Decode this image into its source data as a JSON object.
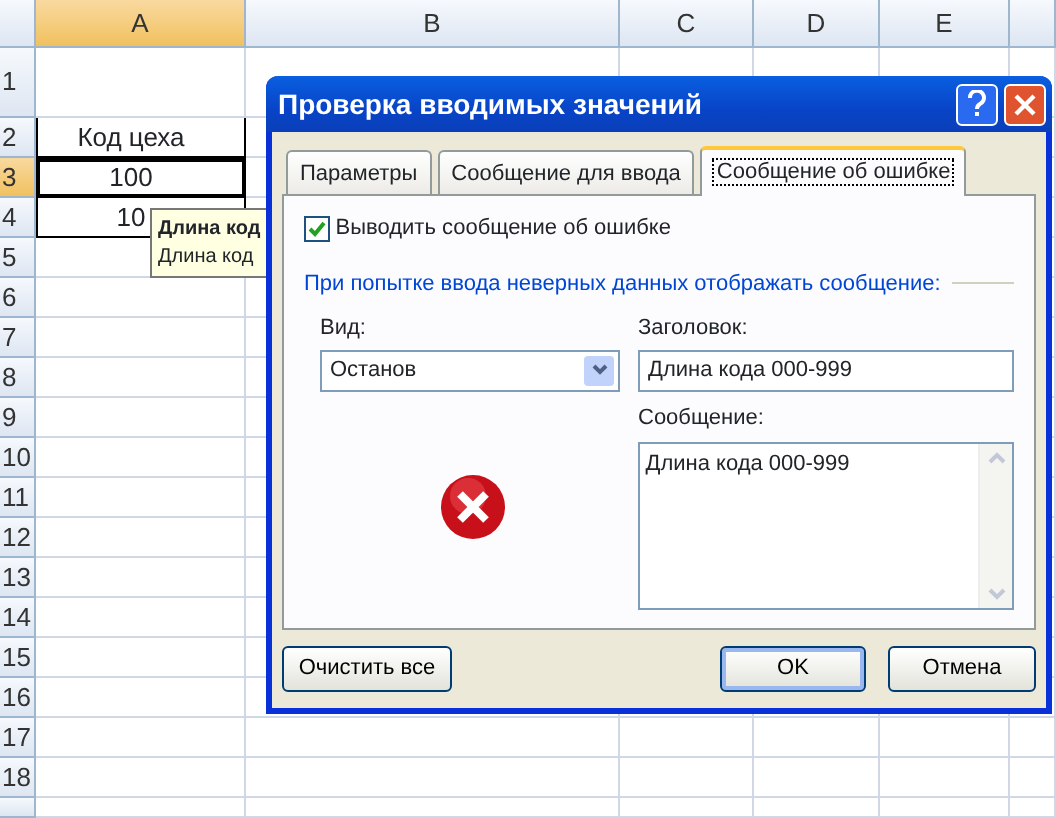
{
  "sheet": {
    "columns": [
      "A",
      "B",
      "C",
      "D",
      "E"
    ],
    "rows": [
      {
        "header": "1",
        "cells": []
      },
      {
        "header": "2",
        "cells": [
          {
            "text": "Код цеха",
            "selected": false
          }
        ]
      },
      {
        "header": "3",
        "cells": [
          {
            "text": "100",
            "selected": true
          }
        ]
      },
      {
        "header": "4",
        "cells": [
          {
            "text": "10",
            "selected": false
          }
        ]
      },
      {
        "header": "5",
        "cells": []
      },
      {
        "header": "6",
        "cells": []
      },
      {
        "header": "7",
        "cells": []
      },
      {
        "header": "8",
        "cells": []
      },
      {
        "header": "9",
        "cells": []
      },
      {
        "header": "10",
        "cells": []
      },
      {
        "header": "11",
        "cells": []
      },
      {
        "header": "12",
        "cells": []
      },
      {
        "header": "13",
        "cells": []
      },
      {
        "header": "14",
        "cells": []
      },
      {
        "header": "15",
        "cells": []
      },
      {
        "header": "16",
        "cells": []
      },
      {
        "header": "17",
        "cells": []
      },
      {
        "header": "18",
        "cells": []
      }
    ]
  },
  "tooltip": {
    "title": "Длина код",
    "text": "Длина код"
  },
  "dialog": {
    "title": "Проверка вводимых значений",
    "tabs": [
      {
        "label": "Параметры",
        "selected": false
      },
      {
        "label": "Сообщение для ввода",
        "selected": false
      },
      {
        "label": "Сообщение об ошибке",
        "selected": true
      }
    ],
    "show_error": {
      "label": "Выводить сообщение об ошибке",
      "checked": true
    },
    "section_label": "При попытке ввода неверных данных отображать сообщение:",
    "style": {
      "label": "Вид:",
      "value": "Останов"
    },
    "title_field": {
      "label": "Заголовок:",
      "value": "Длина кода 000-999"
    },
    "message_field": {
      "label": "Сообщение:",
      "value": "Длина кода 000-999"
    },
    "buttons": [
      {
        "label": "Очистить все",
        "kind": "left"
      },
      {
        "label": "OK",
        "kind": "default"
      },
      {
        "label": "Отмена",
        "kind": "normal"
      }
    ]
  }
}
